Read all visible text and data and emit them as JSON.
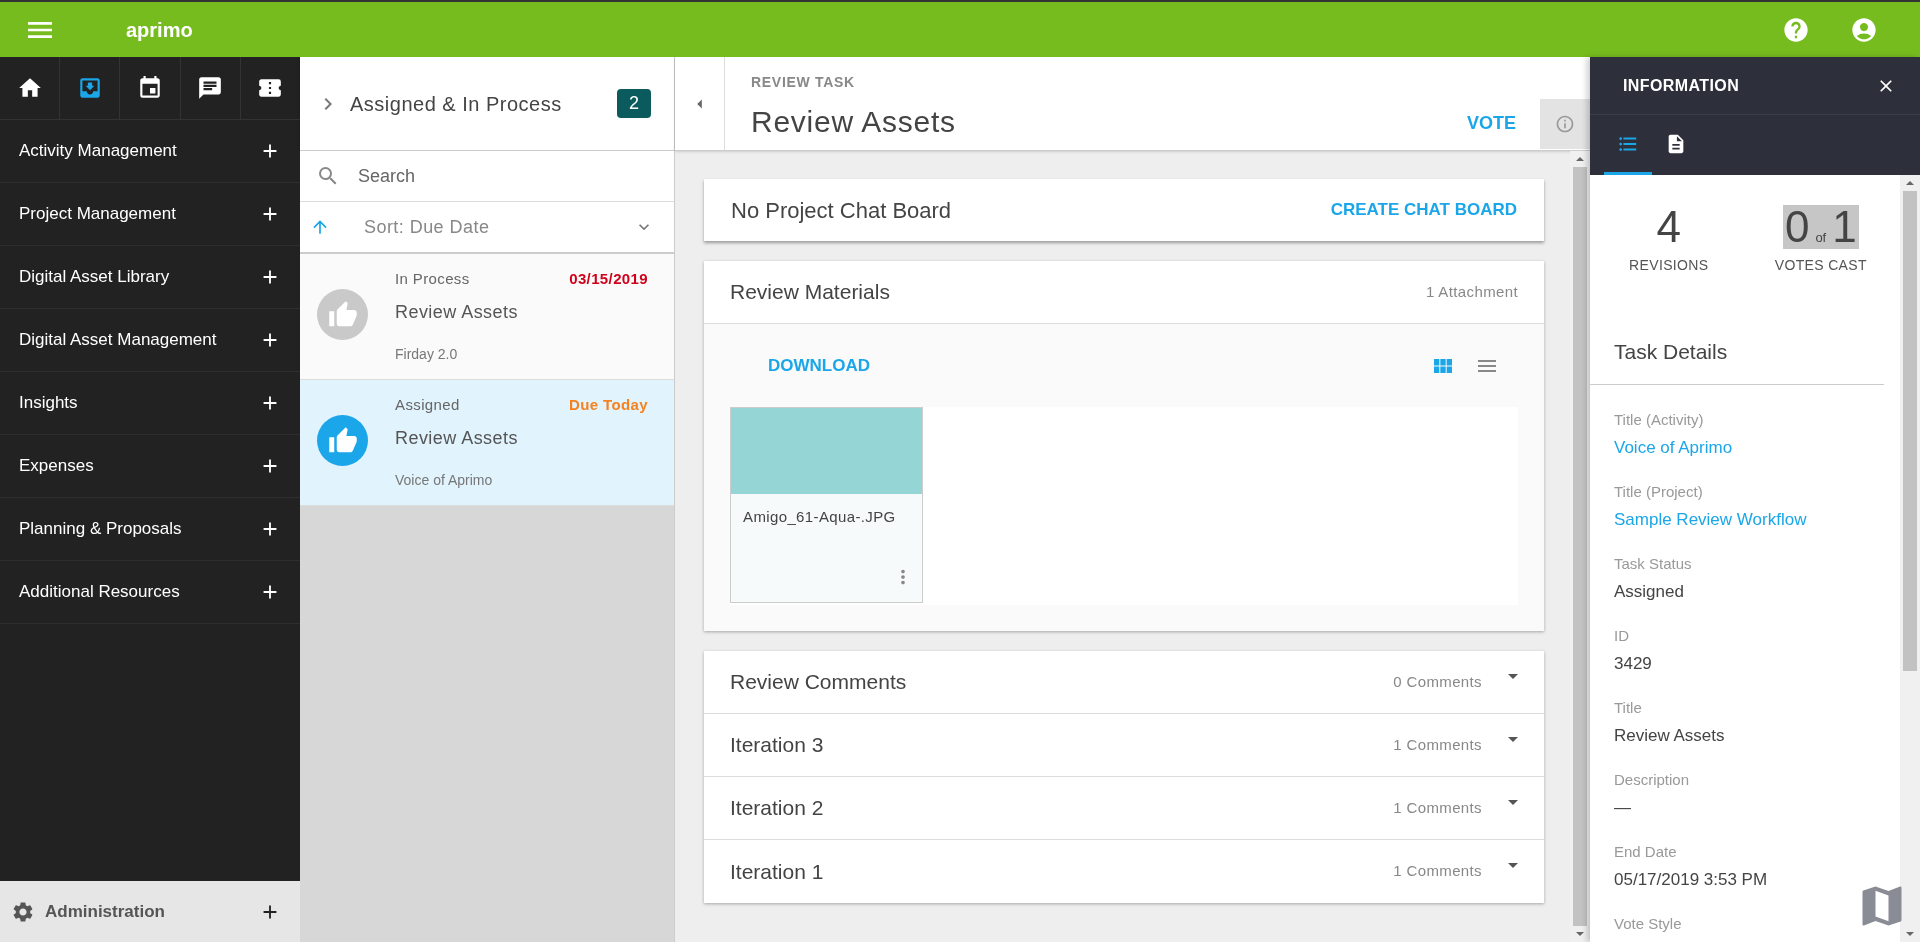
{
  "top_bar": {
    "logo": "aprimo"
  },
  "sidebar": {
    "icons": [
      {
        "kind": "home",
        "selected": false
      },
      {
        "kind": "inbox",
        "selected": true
      },
      {
        "kind": "calendar",
        "selected": false
      },
      {
        "kind": "chat",
        "selected": false
      },
      {
        "kind": "ticket",
        "selected": false
      }
    ],
    "menu": [
      {
        "label": "Activity Management"
      },
      {
        "label": "Project Management"
      },
      {
        "label": "Digital Asset Library"
      },
      {
        "label": "Digital Asset Management"
      },
      {
        "label": "Insights"
      },
      {
        "label": "Expenses"
      },
      {
        "label": "Planning & Proposals"
      },
      {
        "label": "Additional Resources"
      }
    ],
    "footer": {
      "label": "Administration"
    }
  },
  "list_panel": {
    "title": "Assigned & In Process",
    "count": "2",
    "search": {
      "placeholder": "Search"
    },
    "sort": "Sort: Due Date",
    "items": [
      {
        "status": "In Process",
        "due": "03/15/2019",
        "color": "#d0021b",
        "title": "Review Assets",
        "subtitle": "Firday 2.0",
        "selected": false
      },
      {
        "status": "Assigned",
        "due": "Due Today",
        "color": "#f5821f",
        "title": "Review Assets",
        "subtitle": "Voice of Aprimo",
        "selected": true
      }
    ]
  },
  "task": {
    "eyebrow": "REVIEW TASK",
    "title": "Review Assets",
    "action": "VOTE"
  },
  "chat_board": {
    "title": "No Project Chat Board",
    "action": "CREATE CHAT BOARD"
  },
  "review_materials": {
    "title": "Review Materials",
    "count": "1 Attachment",
    "action": "DOWNLOAD",
    "view_options": [
      {
        "kind": "grid",
        "selected": true
      },
      {
        "kind": "list",
        "selected": false
      }
    ],
    "files": [
      {
        "name": "Amigo_61-Aqua-.JPG"
      }
    ]
  },
  "comments": [
    {
      "title": "Review Comments",
      "count": "0 Comments"
    },
    {
      "title": "Iteration 3",
      "count": "1 Comments"
    },
    {
      "title": "Iteration 2",
      "count": "1 Comments"
    },
    {
      "title": "Iteration 1",
      "count": "1 Comments"
    }
  ],
  "info_panel": {
    "title": "INFORMATION",
    "tabs": [
      {
        "kind": "list",
        "selected": true
      },
      {
        "kind": "document",
        "selected": false
      }
    ],
    "revisions": {
      "value": "4",
      "label": "REVISIONS"
    },
    "votes": {
      "cast": "0",
      "of": "of",
      "total": "1",
      "label": "VOTES CAST"
    },
    "section": "Task Details",
    "fields": [
      {
        "label": "Title (Activity)",
        "value": "Voice of Aprimo",
        "kind": "link"
      },
      {
        "label": "Title (Project)",
        "value": "Sample Review Workflow",
        "kind": "link"
      },
      {
        "label": "Task Status",
        "value": "Assigned",
        "kind": "text"
      },
      {
        "label": "ID",
        "value": "3429",
        "kind": "text"
      },
      {
        "label": "Title",
        "value": "Review Assets",
        "kind": "text"
      },
      {
        "label": "Description",
        "value": "—",
        "kind": "text"
      },
      {
        "label": "End Date",
        "value": "05/17/2019 3:53 PM",
        "kind": "text"
      },
      {
        "label": "Vote Style",
        "kind": "label"
      }
    ]
  }
}
